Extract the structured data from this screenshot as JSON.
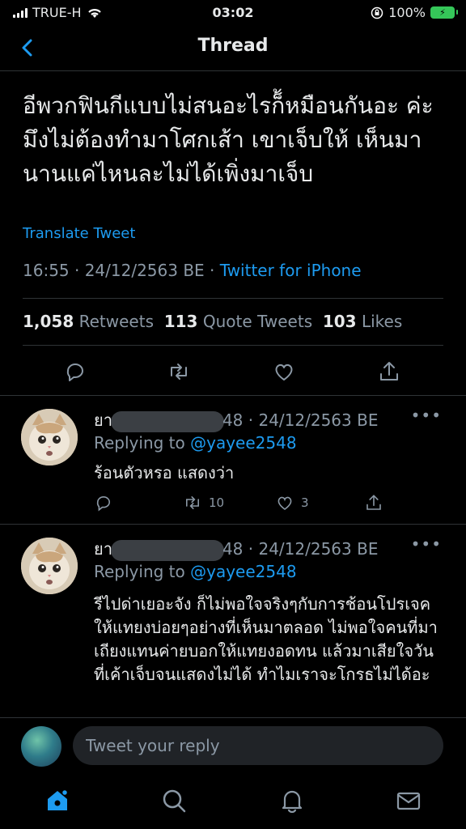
{
  "status_bar": {
    "carrier": "TRUE-H",
    "time": "03:02",
    "battery": "100%"
  },
  "header": {
    "title": "Thread"
  },
  "main_tweet": {
    "text": "อีพวกฟินกีแบบไม่สนอะไรก็้หมือนกันอะ ค่ะมึงไม่ต้องทำมาโศกเส้า เขาเจ็บให้ เห็นมานานแค่ไหนละไม่ได้เพิ่งมาเจ็บ",
    "translate_label": "Translate Tweet",
    "timestamp": "16:55 · 24/12/2563 BE · ",
    "source": "Twitter for iPhone",
    "retweets_count": "1,058",
    "retweets_label": "Retweets",
    "quotes_count": "113",
    "quotes_label": "Quote Tweets",
    "likes_count": "103",
    "likes_label": "Likes"
  },
  "replies": [
    {
      "name_prefix": "ยา",
      "handle_suffix": "48",
      "date": " · 24/12/2563 BE",
      "replying_label": "Replying to ",
      "replying_to": "@yayee2548",
      "text": "ร้อนตัวหรอ แสดงว่า",
      "retweets": "10",
      "likes": "3"
    },
    {
      "name_prefix": "ยา",
      "handle_suffix": "48",
      "date": " · 24/12/2563 BE",
      "replying_label": "Replying to ",
      "replying_to": "@yayee2548",
      "text": "รีไปด่าเยอะจัง ก็ไม่พอใจจริงๆกับการช้อนโปรเจคให้แทยงบ่อยๆอย่างที่เห็นมาตลอด ไม่พอใจคนที่มาเถียงแทนค่ายบอกให้แทยงอดทน แล้วมาเสียใจวันที่เค้าเจ็บจนแสดงไม่ได้ ทำไมเราจะโกรธไม่ได้อะ"
    }
  ],
  "compose": {
    "placeholder": "Tweet your reply"
  },
  "icons": {
    "back": "chevron-left-icon",
    "reply": "reply-icon",
    "retweet": "retweet-icon",
    "like": "heart-icon",
    "share": "share-icon",
    "more": "more-icon",
    "home": "home-icon",
    "search": "search-icon",
    "notifications": "bell-icon",
    "messages": "mail-icon"
  },
  "colors": {
    "background": "#000000",
    "accent": "#1d9bf0",
    "muted": "#8b98a5",
    "battery": "#35c759"
  }
}
